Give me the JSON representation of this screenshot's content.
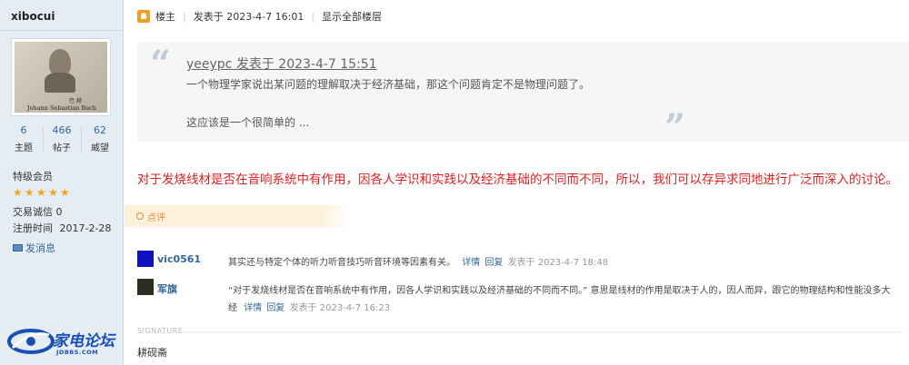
{
  "user": {
    "name": "xibocui",
    "avatar_caption_1": "巴 赫",
    "avatar_caption_2": "Johann Sebastian Bach",
    "stats": [
      {
        "value": "6",
        "label": "主题"
      },
      {
        "value": "466",
        "label": "帖子"
      },
      {
        "value": "62",
        "label": "威望"
      }
    ],
    "rank": "特级会员",
    "stars": 5,
    "trade_credit": "交易诚信 0",
    "reg_label": "注册时间",
    "reg_date": "2017-2-28",
    "pm_label": "发消息"
  },
  "logo": {
    "cn": "家电论坛",
    "en": "JDBBS.COM"
  },
  "post": {
    "owner_label": "楼主",
    "posted": "发表于 2023-4-7 16:01",
    "show_all": "显示全部楼层",
    "quote": {
      "head": "yeeypc 发表于 2023-4-7 15:51",
      "line1": "一个物理学家说出某问题的理解取决于经济基础，那这个问题肯定不是物理问题了。",
      "line2": "这应该是一个很简单的 ..."
    },
    "reply": "对于发烧线材是否在音响系统中有作用，因各人学识和实践以及经济基础的不同而不同，所以，我们可以存异求同地进行广泛而深入的讨论。"
  },
  "comments_tab": "点评",
  "comments": [
    {
      "name": "vic0561",
      "text": "其实还与特定个体的听力听音技巧听音环境等因素有关。",
      "detail": "详情",
      "reply": "回复",
      "time": "发表于 2023-4-7 18:48"
    },
    {
      "name": "军旗",
      "text": "“对于发烧线材是否在音响系统中有作用，因各人学识和实践以及经济基础的不同而不同。”  意思是线材的作用是取决于人的，因人而异，跟它的物理结构和性能没多大",
      "text_cont": "经",
      "detail": "详情",
      "reply": "回复",
      "time": "发表于 2023-4-7 16:23"
    }
  ],
  "signature": {
    "label": "SIGNATURE",
    "text": "耕砚斋"
  },
  "colors": {
    "sidebar_bg": "#e5edf2",
    "link": "#336699",
    "reply_red": "#e02020",
    "comment_orange": "#e08d3c"
  }
}
